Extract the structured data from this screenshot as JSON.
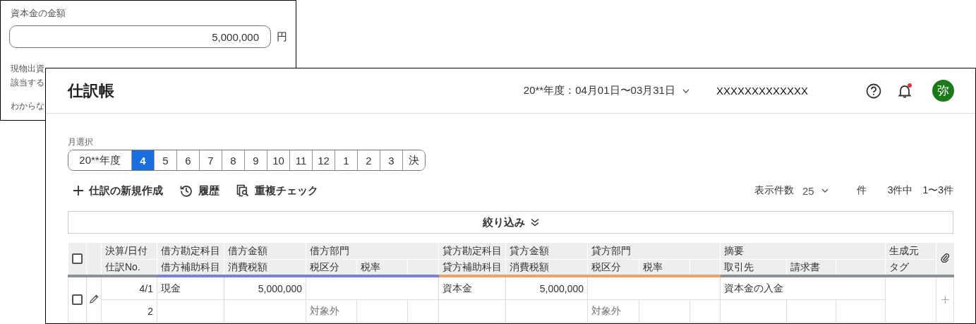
{
  "back_panel": {
    "field_label": "資本金の金額",
    "amount": "5,000,000",
    "unit": "円",
    "notes": [
      "現物出資",
      "該当する",
      "わからな"
    ]
  },
  "window": {
    "title": "仕訳帳",
    "period": "20**年度：04月01日〜03月31日",
    "company": "XXXXXXXXXXXXX",
    "has_notification": true,
    "avatar": "弥"
  },
  "month_select": {
    "label": "月選択",
    "tabs": [
      {
        "label": "20**年度",
        "selected": false
      },
      {
        "label": "4",
        "selected": true
      },
      {
        "label": "5",
        "selected": false
      },
      {
        "label": "6",
        "selected": false
      },
      {
        "label": "7",
        "selected": false
      },
      {
        "label": "8",
        "selected": false
      },
      {
        "label": "9",
        "selected": false
      },
      {
        "label": "10",
        "selected": false
      },
      {
        "label": "11",
        "selected": false
      },
      {
        "label": "12",
        "selected": false
      },
      {
        "label": "1",
        "selected": false
      },
      {
        "label": "2",
        "selected": false
      },
      {
        "label": "3",
        "selected": false
      },
      {
        "label": "決",
        "selected": false
      }
    ]
  },
  "actions": [
    {
      "kind": "add",
      "label": "仕訳の新規作成"
    },
    {
      "kind": "history",
      "label": "履歴"
    },
    {
      "kind": "duplicate",
      "label": "重複チェック"
    }
  ],
  "pager": {
    "per_page_label": "表示件数",
    "per_page": "25",
    "unit": "件",
    "total": "3件中",
    "range": "1〜3件"
  },
  "filter": {
    "label": "絞り込み"
  },
  "table": {
    "select_all": {
      "checked": false
    },
    "groups": [
      {
        "kind": "single",
        "top": "決算/日付",
        "bottom": [
          "仕訳No."
        ],
        "color": "#8c9096"
      },
      {
        "kind": "single",
        "top": "借方勘定科目",
        "bottom": [
          "借方補助科目"
        ],
        "color": "#7c80d6"
      },
      {
        "kind": "single",
        "top": "借方金額",
        "bottom": [
          "消費税額"
        ],
        "color": "#7c80d6"
      },
      {
        "kind": "split",
        "top": "借方部門",
        "bottom": [
          "税区分",
          "税率"
        ],
        "color": "#7c80d6"
      },
      {
        "kind": "single",
        "top": "貸方勘定科目",
        "bottom": [
          "貸方補助科目"
        ],
        "color": "#e9a36b"
      },
      {
        "kind": "single",
        "top": "貸方金額",
        "bottom": [
          "消費税額"
        ],
        "color": "#e9a36b"
      },
      {
        "kind": "split",
        "top": "貸方部門",
        "bottom": [
          "税区分",
          "税率"
        ],
        "color": "#e9a36b"
      },
      {
        "kind": "split",
        "top": "摘要",
        "bottom": [
          "取引先",
          "請求書"
        ],
        "color": "#8c9096"
      },
      {
        "kind": "single",
        "top": "生成元",
        "bottom": [
          "タグ"
        ],
        "color": "#8c9096"
      }
    ],
    "rows": [
      {
        "checked": false,
        "date": "4/1",
        "number": "2",
        "debit_account": "現金",
        "debit_amount": "5,000,000",
        "debit_tax_category": "対象外",
        "credit_account": "資本金",
        "credit_amount": "5,000,000",
        "credit_tax_category": "対象外",
        "description": "資本金の入金"
      }
    ]
  }
}
